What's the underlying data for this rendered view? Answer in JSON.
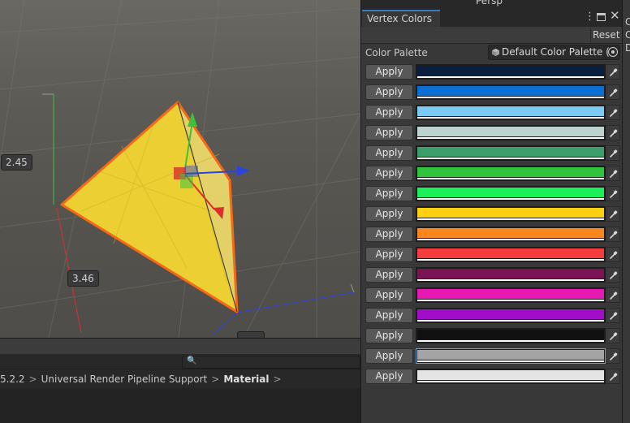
{
  "scene": {
    "label_left": "2.45",
    "label_bottom": "3.46",
    "gizmo_label": "Persp"
  },
  "panel": {
    "tab_title": "Vertex Colors",
    "reset_label": "Reset",
    "palette_label": "Color Palette",
    "palette_value": "Default Color Palette (C",
    "apply_label": "Apply",
    "colors": [
      "#0a1f3f",
      "#0a6fd4",
      "#7cc9f4",
      "#bcd3cf",
      "#3c9e6b",
      "#30c43e",
      "#1bf05a",
      "#fdd112",
      "#fb861e",
      "#f43d3c",
      "#7a1452",
      "#e61ab2",
      "#a20dc9",
      "#111111",
      "#a4a4a4",
      "#e4e4e4"
    ],
    "selected_index": 14
  },
  "bottom": {
    "breadcrumb": [
      "5.2.2",
      "Universal Render Pipeline Support",
      "Material"
    ]
  },
  "right_sliver": {
    "letters": [
      "C",
      "C",
      "D"
    ]
  },
  "colors": {
    "accent": "#3a79bb",
    "object_fill": "#f2d532",
    "outline": "#f56a19"
  }
}
